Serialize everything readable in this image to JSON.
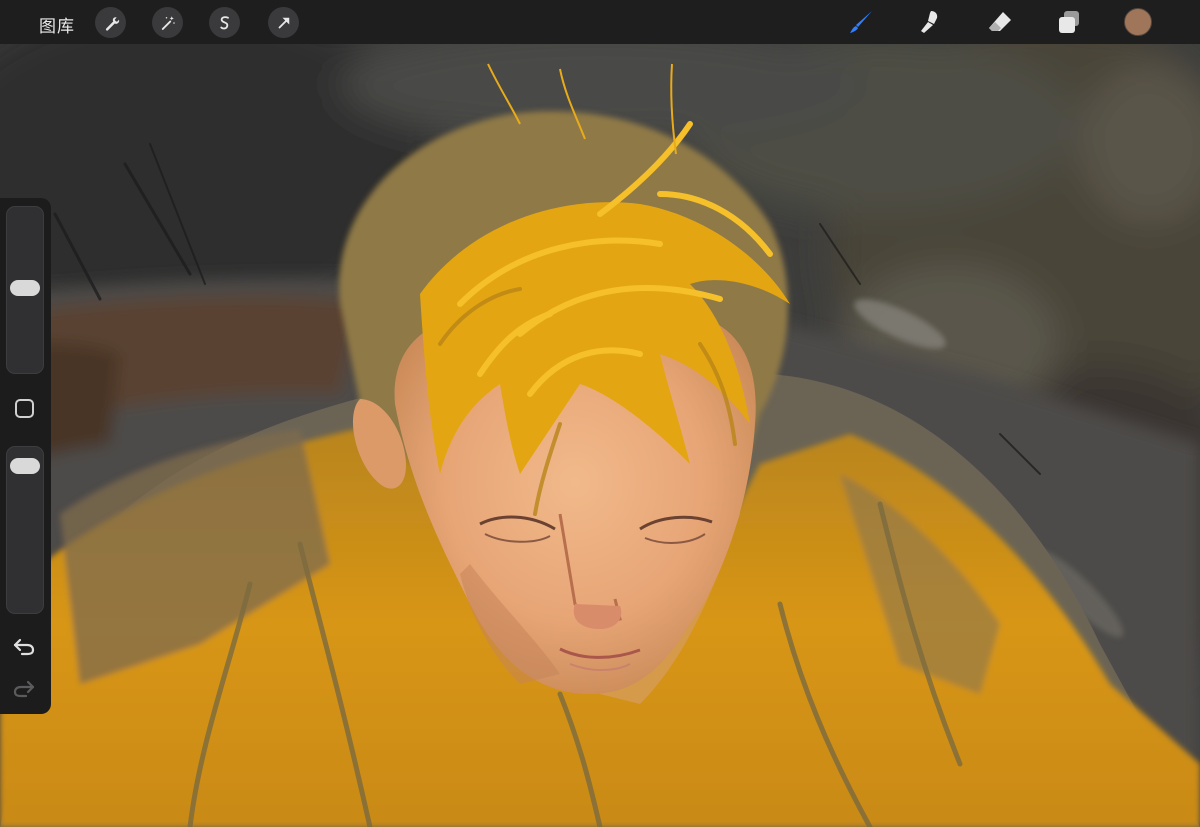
{
  "app": {
    "gallery_label": "图库"
  },
  "toolbar_left": {
    "actions": [
      {
        "name": "actions",
        "icon": "wrench-icon"
      },
      {
        "name": "adjustments",
        "icon": "magic-wand-icon"
      },
      {
        "name": "selection",
        "icon": "selection-s-icon"
      },
      {
        "name": "transform",
        "icon": "arrow-cursor-icon"
      }
    ]
  },
  "toolbar_right": {
    "tools": [
      {
        "name": "brush",
        "icon": "brush-icon",
        "active": true
      },
      {
        "name": "smudge",
        "icon": "smudge-finger-icon",
        "active": false
      },
      {
        "name": "eraser",
        "icon": "eraser-icon",
        "active": false
      },
      {
        "name": "layers",
        "icon": "layers-icon",
        "active": false
      }
    ],
    "active_color": "#a0765a"
  },
  "sidebar": {
    "brush_size_level": 0.52,
    "opacity_level": 0.95,
    "icons": [
      "modify-square-icon",
      "undo-icon",
      "redo-icon"
    ]
  },
  "colors": {
    "accent_blue": "#2f7fff",
    "toolbar_bg": "#1e1e1f"
  }
}
